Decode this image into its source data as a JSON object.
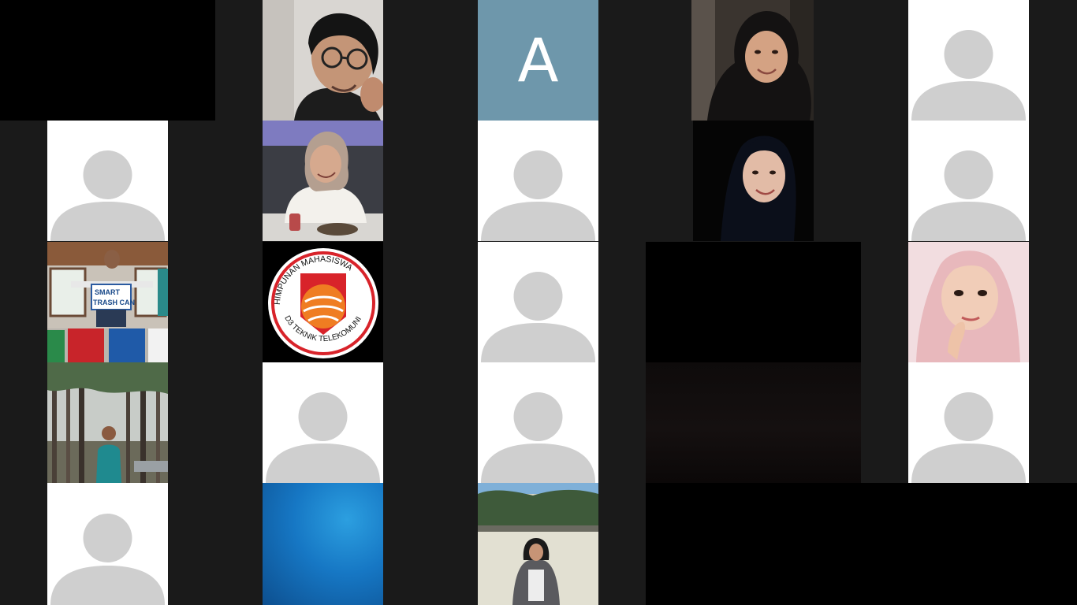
{
  "meeting": {
    "view": "gallery",
    "participants": [
      {
        "id": "p01",
        "kind": "black"
      },
      {
        "id": "p02",
        "kind": "photo",
        "photo": "young man with round glasses"
      },
      {
        "id": "p03",
        "kind": "initial",
        "initial": "A"
      },
      {
        "id": "p04",
        "kind": "photo",
        "photo": "woman in black hijab"
      },
      {
        "id": "p05",
        "kind": "avatar"
      },
      {
        "id": "p06",
        "kind": "avatar"
      },
      {
        "id": "p07",
        "kind": "photo",
        "photo": "woman in beige hijab at restaurant"
      },
      {
        "id": "p08",
        "kind": "avatar"
      },
      {
        "id": "p09",
        "kind": "photo",
        "photo": "woman in black hijab on dark background"
      },
      {
        "id": "p10",
        "kind": "avatar"
      },
      {
        "id": "p11",
        "kind": "photo",
        "photo": "man holding smart trash can sign",
        "sign_line1": "SMART",
        "sign_line2": "TRASH CAN"
      },
      {
        "id": "p12",
        "kind": "logo",
        "logo_top": "HIMPUNAN MAHASISWA",
        "logo_bottom": "D3 TEKNIK TELEKOMUNIKASI"
      },
      {
        "id": "p13",
        "kind": "avatar"
      },
      {
        "id": "p14",
        "kind": "black"
      },
      {
        "id": "p15",
        "kind": "photo",
        "photo": "girl in pink hijab"
      },
      {
        "id": "p16",
        "kind": "photo",
        "photo": "man in pine forest"
      },
      {
        "id": "p17",
        "kind": "avatar"
      },
      {
        "id": "p18",
        "kind": "avatar"
      },
      {
        "id": "p19",
        "kind": "dark"
      },
      {
        "id": "p20",
        "kind": "avatar"
      },
      {
        "id": "p21",
        "kind": "avatar"
      },
      {
        "id": "p22",
        "kind": "blue"
      },
      {
        "id": "p23",
        "kind": "photo",
        "photo": "woman in hijab at crater lake"
      },
      {
        "id": "p24",
        "kind": "black"
      }
    ]
  },
  "colors": {
    "background": "#1a1a1a",
    "avatar_placeholder": "#cfcfcf",
    "initial_tile": "#6e97ab",
    "logo_orange": "#ef7d22",
    "logo_red": "#d8232a"
  }
}
